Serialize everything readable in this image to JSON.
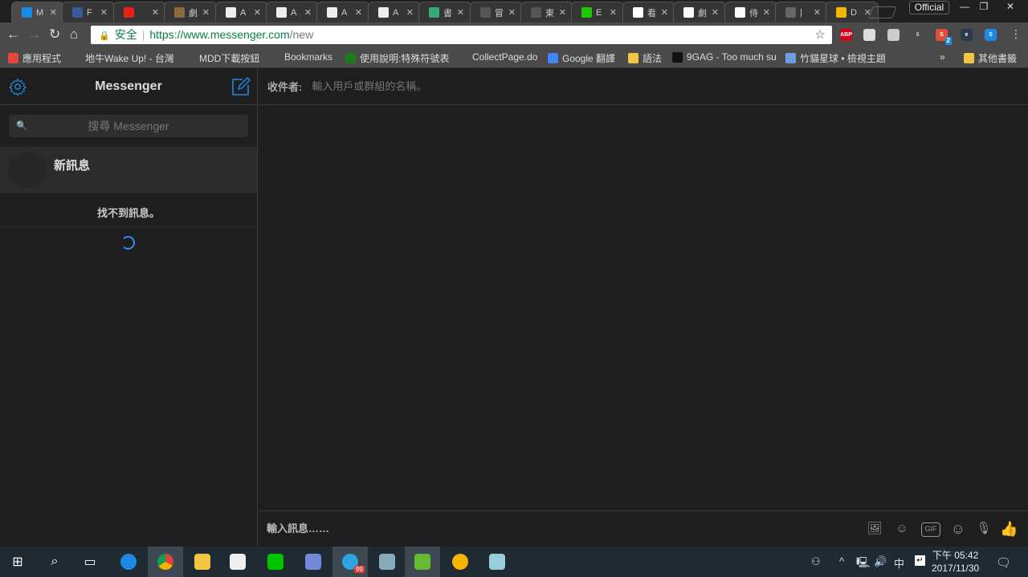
{
  "browser": {
    "tabs": [
      {
        "label": "M",
        "icon": "messenger-icon",
        "color": "#1e88e5",
        "active": true
      },
      {
        "label": "F",
        "icon": "facebook-icon",
        "color": "#3b5998"
      },
      {
        "label": "",
        "icon": "youtube-icon",
        "color": "#e62117"
      },
      {
        "label": "劇",
        "icon": "image-icon",
        "color": "#8a6a3a"
      },
      {
        "label": "A",
        "icon": "chart-icon",
        "color": "#eeeeee"
      },
      {
        "label": "A",
        "icon": "chart-icon",
        "color": "#eeeeee"
      },
      {
        "label": "A",
        "icon": "chart-icon",
        "color": "#eeeeee"
      },
      {
        "label": "A",
        "icon": "chart-icon",
        "color": "#eeeeee"
      },
      {
        "label": "書",
        "icon": "bird-icon",
        "color": "#3a7"
      },
      {
        "label": "冒",
        "icon": "page-icon",
        "color": "#555555"
      },
      {
        "label": "東",
        "icon": "page-icon",
        "color": "#555555"
      },
      {
        "label": "E",
        "icon": "naver-icon",
        "color": "#1ec800"
      },
      {
        "label": "看",
        "icon": "wikipedia-icon",
        "color": "#ffffff"
      },
      {
        "label": "劇",
        "icon": "wikipedia-icon",
        "color": "#ffffff"
      },
      {
        "label": "侍",
        "icon": "wikipedia-icon",
        "color": "#ffffff"
      },
      {
        "label": "|",
        "icon": "dragon-icon",
        "color": "#666666"
      },
      {
        "label": "D",
        "icon": "mail-icon",
        "color": "#f4b400"
      }
    ],
    "profile": "Official",
    "window": {
      "minimize": "—",
      "restore": "❐",
      "close": "✕"
    },
    "security_label": "安全",
    "url_host": "https://www.messenger.com",
    "url_path": "/new",
    "extensions": [
      {
        "name": "adblock-plus-icon",
        "label": "ABP",
        "color": "#d0021b"
      },
      {
        "name": "extension-note-icon",
        "label": "",
        "color": "#dddddd"
      },
      {
        "name": "extension-circle-icon",
        "label": "",
        "color": "#cccccc"
      },
      {
        "name": "download-icon",
        "label": "⇩",
        "color": "#4a4a4a"
      },
      {
        "name": "extension-s-icon",
        "label": "S",
        "color": "#e14e3b",
        "badge": "2"
      },
      {
        "name": "extension-e-icon",
        "label": "e",
        "color": "#2b3a4a"
      },
      {
        "name": "extension-blue-s-icon",
        "label": "S",
        "color": "#1e88e5"
      }
    ],
    "bookmarks": [
      {
        "label": "應用程式",
        "color": "#e8453c"
      },
      {
        "label": "地牛Wake Up! - 台灣",
        "color": "#4a4a4a"
      },
      {
        "label": "MDD下載按鈕",
        "color": "#4a4a4a"
      },
      {
        "label": "Bookmarks",
        "color": "#4a4a4a"
      },
      {
        "label": "使用說明:特殊符號表",
        "color": "#1b7a1b"
      },
      {
        "label": "CollectPage.do",
        "color": "#4a4a4a"
      },
      {
        "label": "Google 翻譯",
        "color": "#4285f4"
      },
      {
        "label": "語法",
        "color": "#f4c542"
      },
      {
        "label": "9GAG - Too much su",
        "color": "#111111"
      },
      {
        "label": "竹貓星球 • 檢視主題",
        "color": "#6aa0e0"
      }
    ],
    "more_bookmarks": "»",
    "other_bookmarks": "其他書籤"
  },
  "messenger": {
    "title": "Messenger",
    "search_placeholder": "搜尋 Messenger",
    "new_message": "新訊息",
    "no_messages": "找不到訊息。",
    "to_label": "收件者:",
    "to_placeholder": "輸入用戶或群組的名稱。",
    "compose_placeholder": "輸入訊息……",
    "accent": "#1e88e5",
    "composer_icons": {
      "gif": "GIF"
    }
  },
  "taskbar": {
    "telegram_badge": "99",
    "ime": "中",
    "time": "下午 05:42",
    "date": "2017/11/30"
  }
}
